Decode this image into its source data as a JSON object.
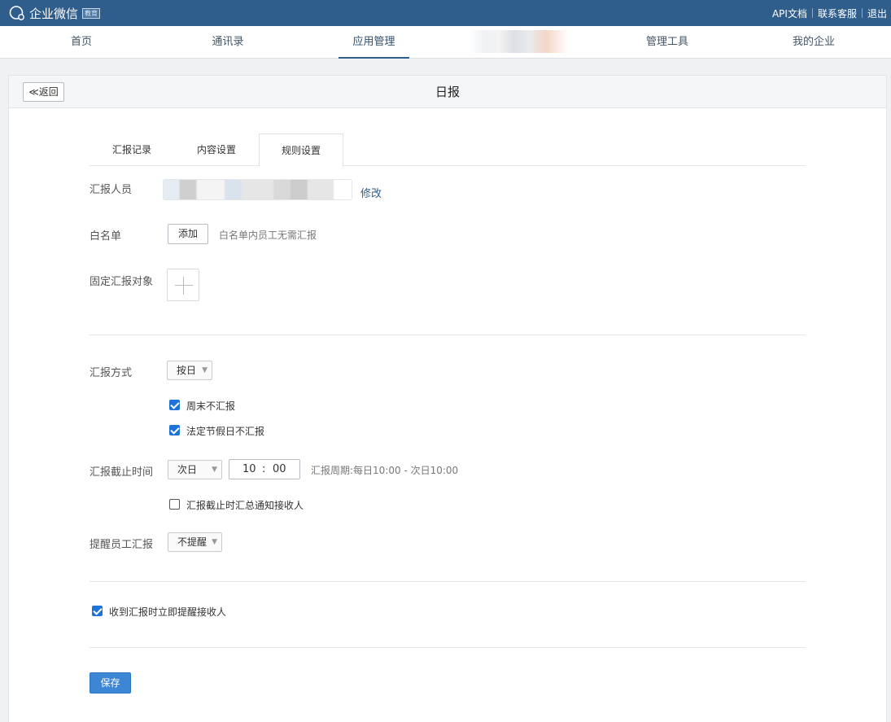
{
  "topbar": {
    "logo_text": "企业微信",
    "badge": "教育",
    "links": [
      "API文档",
      "联系客服",
      "退出"
    ]
  },
  "nav": {
    "items": [
      "首页",
      "通讯录",
      "应用管理",
      "管理工具",
      "我的企业"
    ],
    "active": "应用管理"
  },
  "header": {
    "back_label": "≪返回",
    "title": "日报"
  },
  "tabs": {
    "items": [
      "汇报记录",
      "内容设置",
      "规则设置"
    ],
    "active": "规则设置"
  },
  "form": {
    "reporters_label": "汇报人员",
    "reporters_edit": "修改",
    "whitelist_label": "白名单",
    "whitelist_add": "添加",
    "whitelist_hint": "白名单内员工无需汇报",
    "target_label": "固定汇报对象",
    "mode_label": "汇报方式",
    "mode_value": "按日",
    "weekend_label": "周末不汇报",
    "weekend_checked": true,
    "holiday_label": "法定节假日不汇报",
    "holiday_checked": true,
    "deadline_label": "汇报截止时间",
    "deadline_day": "次日",
    "deadline_hour": "10",
    "deadline_sep": ":",
    "deadline_minute": "00",
    "deadline_hint": "汇报周期:每日10:00 - 次日10:00",
    "deadline_summary_label": "汇报截止时汇总通知接收人",
    "deadline_summary_checked": false,
    "remind_label": "提醒员工汇报",
    "remind_value": "不提醒",
    "notify_label": "收到汇报时立即提醒接收人",
    "notify_checked": true,
    "save_label": "保存"
  },
  "colors": {
    "topbar": "#2f5d8c",
    "primary_button": "#3d86d6",
    "checkbox": "#1e73d9",
    "link": "#2f5d8c"
  }
}
